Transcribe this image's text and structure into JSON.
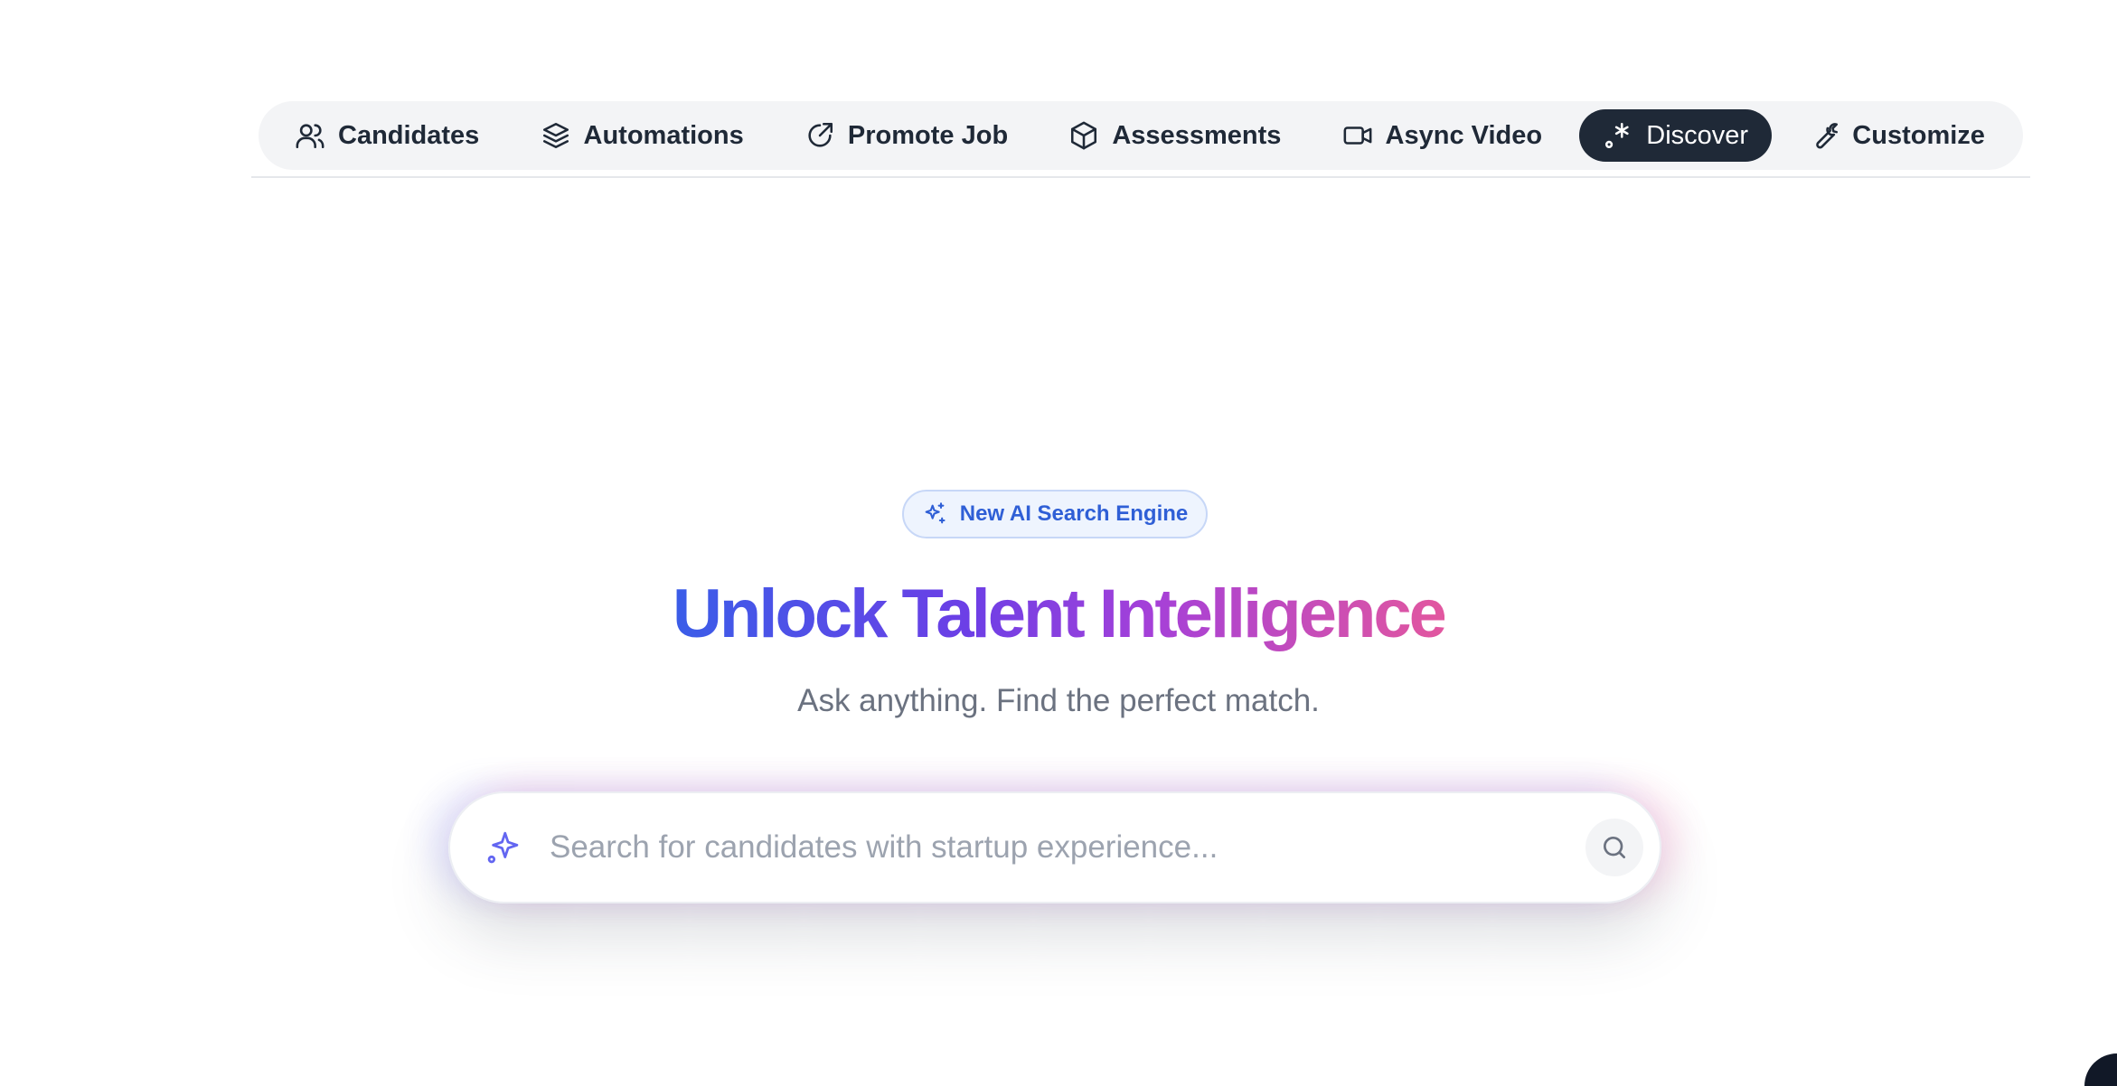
{
  "nav": {
    "items": [
      {
        "label": "Candidates",
        "icon": "users-icon"
      },
      {
        "label": "Automations",
        "icon": "layers-icon"
      },
      {
        "label": "Promote Job",
        "icon": "share-arrow-icon"
      },
      {
        "label": "Assessments",
        "icon": "cube-icon"
      },
      {
        "label": "Async Video",
        "icon": "video-icon"
      },
      {
        "label": "Discover",
        "icon": "discover-sparkle-icon",
        "active": true
      },
      {
        "label": "Customize",
        "icon": "wrench-icon"
      }
    ]
  },
  "hero": {
    "badge": "New AI Search Engine",
    "headline": "Unlock Talent Intelligence",
    "subhead": "Ask anything. Find the perfect match."
  },
  "search": {
    "placeholder": "Search for candidates with startup experience...",
    "value": ""
  },
  "colors": {
    "nav_active_bg": "#1f2937",
    "badge_text": "#2f5fd6",
    "gradient_start": "#3a5de8",
    "gradient_mid": "#a540d8",
    "gradient_end": "#e2579f",
    "spark_icon": "#6366f1"
  }
}
